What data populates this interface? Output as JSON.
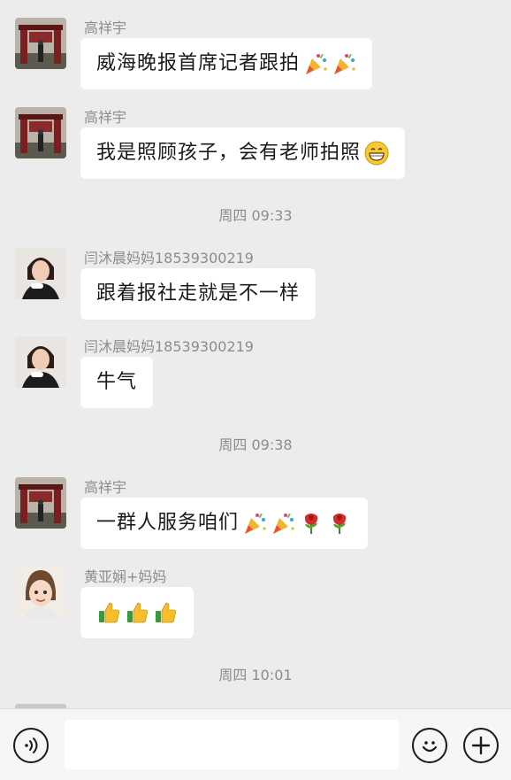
{
  "messages": [
    {
      "sender": "高祥宇",
      "text": "威海晚报首席记者跟拍",
      "emojis": [
        "party-popper",
        "party-popper"
      ],
      "avatar": "gate-photo"
    },
    {
      "sender": "高祥宇",
      "text": "我是照顾孩子，会有老师拍照",
      "emojis": [
        "grinning-face"
      ],
      "avatar": "gate-photo"
    },
    {
      "time": "周四 09:33"
    },
    {
      "sender": "闫沐晨妈妈18539300219",
      "text": "跟着报社走就是不一样",
      "emojis": [],
      "avatar": "woman-photo"
    },
    {
      "sender": "闫沐晨妈妈18539300219",
      "text": "牛气",
      "emojis": [],
      "avatar": "woman-photo"
    },
    {
      "time": "周四 09:38"
    },
    {
      "sender": "高祥宇",
      "text": "一群人服务咱们",
      "emojis": [
        "party-popper",
        "party-popper",
        "rose",
        "rose"
      ],
      "avatar": "gate-photo"
    },
    {
      "sender": "黄亚娴+妈妈",
      "text": "",
      "emojis": [
        "thumbs-up",
        "thumbs-up",
        "thumbs-up"
      ],
      "avatar": "child-photo"
    },
    {
      "time": "周四 10:01"
    }
  ],
  "input_bar": {
    "voice_icon": "voice-icon",
    "emoji_icon": "smiley-icon",
    "more_icon": "plus-icon",
    "text_value": ""
  },
  "colors": {
    "background": "#ececec",
    "bubble": "#ffffff",
    "meta_text": "#8c8c8c"
  }
}
